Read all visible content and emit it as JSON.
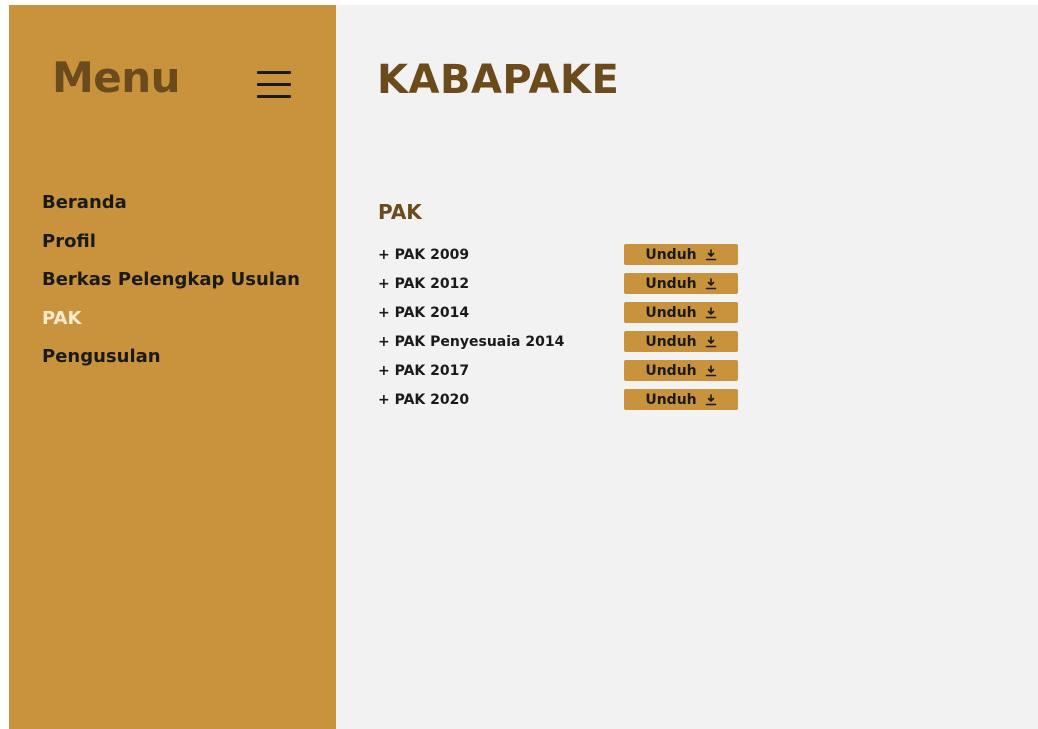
{
  "sidebar": {
    "title": "Menu",
    "menu_icon": "hamburger-menu-icon",
    "items": [
      {
        "label": "Beranda",
        "active": false
      },
      {
        "label": "Profil",
        "active": false
      },
      {
        "label": "Berkas Pelengkap Usulan",
        "active": false
      },
      {
        "label": "PAK",
        "active": true
      },
      {
        "label": "Pengusulan",
        "active": false
      }
    ]
  },
  "main": {
    "title": "KABAPAKE",
    "section_title": "PAK",
    "items": [
      {
        "label": "+ PAK 2009",
        "button": "Unduh"
      },
      {
        "label": "+ PAK 2012",
        "button": "Unduh"
      },
      {
        "label": "+ PAK 2014",
        "button": "Unduh"
      },
      {
        "label": "+ PAK Penyesuaia 2014",
        "button": "Unduh"
      },
      {
        "label": "+ PAK 2017",
        "button": "Unduh"
      },
      {
        "label": "+ PAK 2020",
        "button": "Unduh"
      }
    ],
    "download_icon": "download-icon"
  },
  "colors": {
    "sidebar_bg": "#c9933e",
    "title_brown": "#6b4a1c",
    "active_item": "#faebd0",
    "main_bg": "#f2f2f2"
  }
}
